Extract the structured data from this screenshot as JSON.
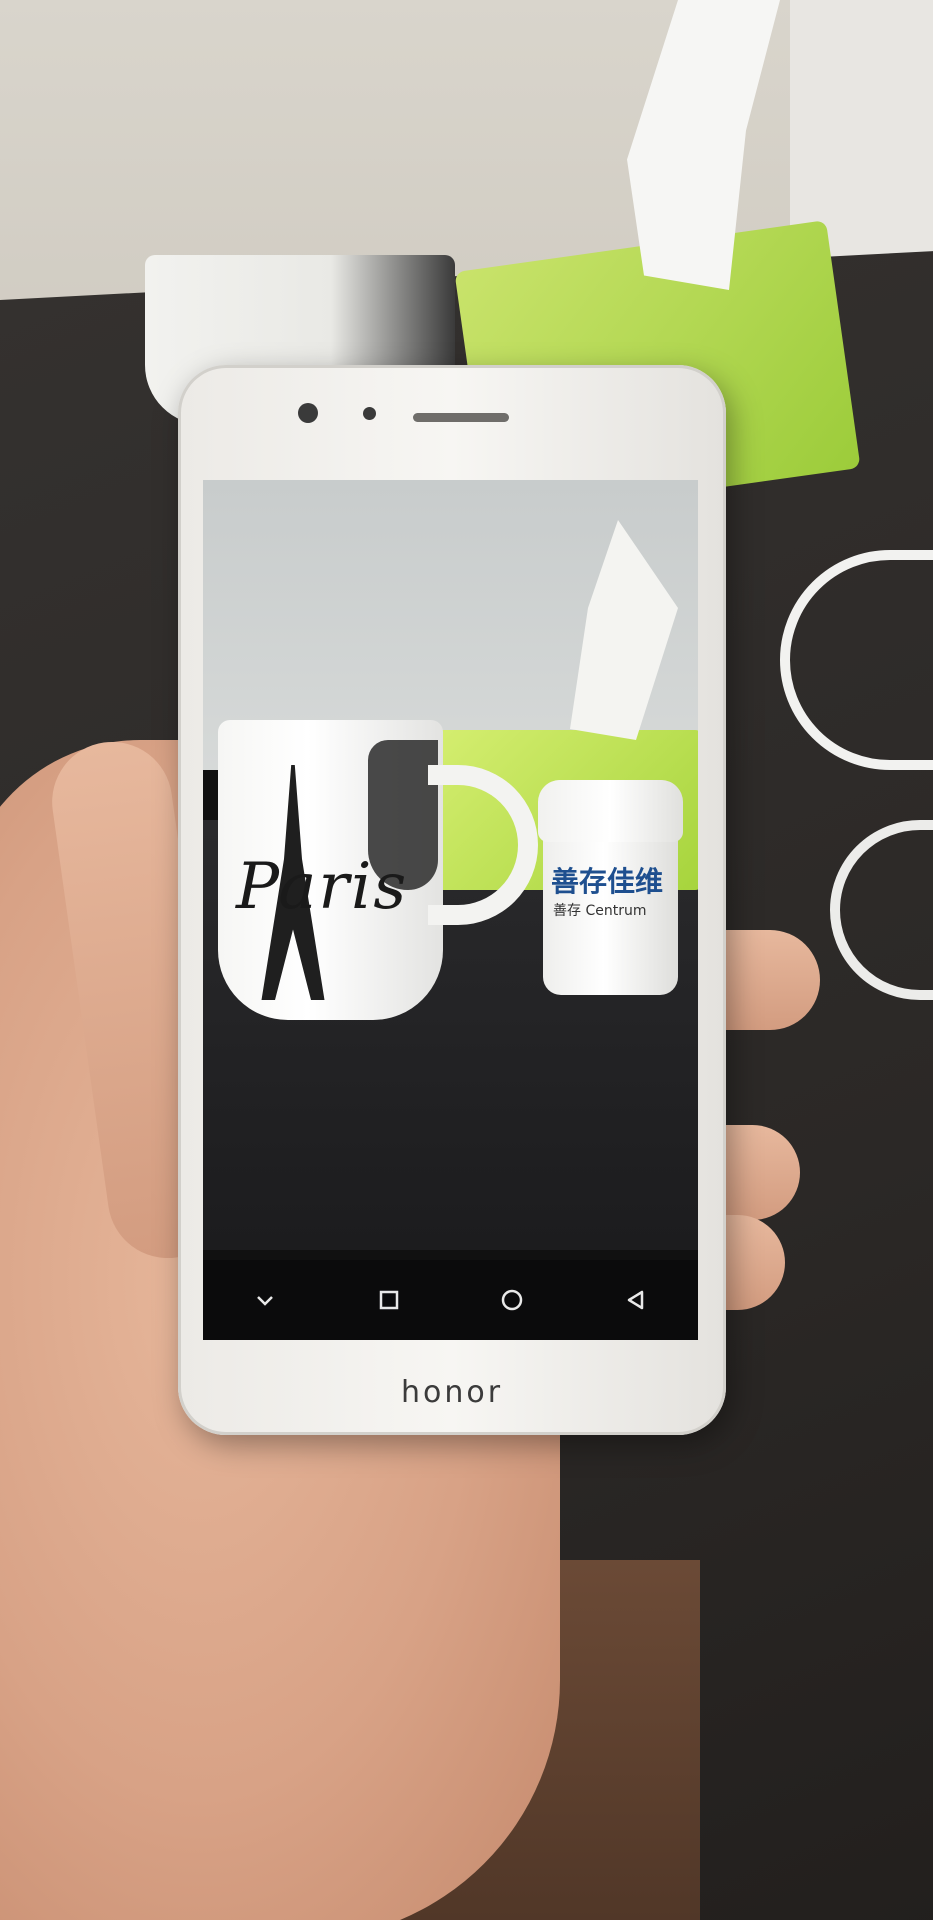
{
  "scene": {
    "device": {
      "brand_label": "honor",
      "screen_photo": {
        "mug_print": "Paris",
        "bottle_label": "善存佳维",
        "bottle_sub_label": "善存 Centrum"
      },
      "navbar": {
        "buttons": [
          {
            "name": "hide-navbar",
            "icon": "chevron-down-icon"
          },
          {
            "name": "recent-apps",
            "icon": "square-icon"
          },
          {
            "name": "home",
            "icon": "circle-icon"
          },
          {
            "name": "back",
            "icon": "triangle-back-icon"
          }
        ]
      },
      "color": "#f2f0ec"
    },
    "colors": {
      "navbar": "#0b0b0c",
      "nav_icon": "#e9e9e9"
    }
  }
}
